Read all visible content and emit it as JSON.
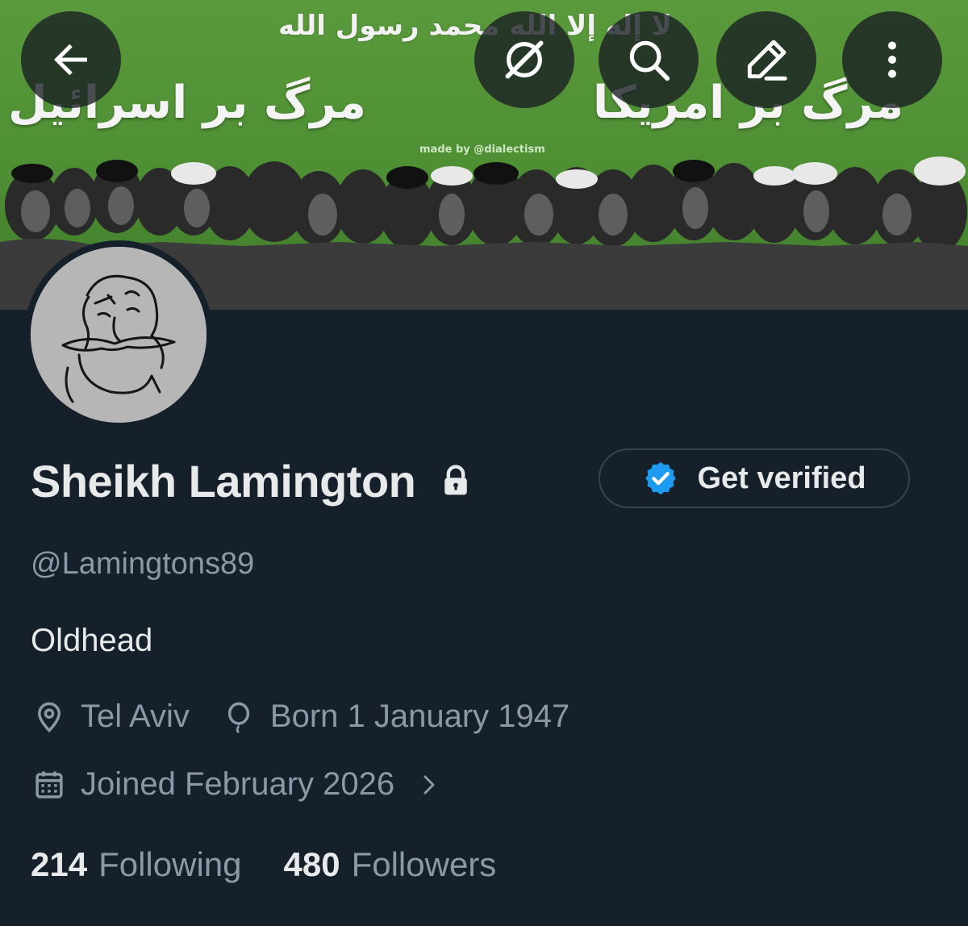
{
  "banner": {
    "shahada": "لا إله إلا الله محمد رسول الله",
    "slogan_left": "مرگ بر اسرائیل",
    "slogan_right": "مرگ بر امریکا",
    "credit": "made by @dialectism"
  },
  "top_bar": {
    "icons": [
      "back-arrow-icon",
      "grok-icon",
      "search-icon",
      "edit-icon",
      "more-vertical-icon"
    ]
  },
  "profile": {
    "display_name": "Sheikh Lamington",
    "protected_icon": "lock-icon",
    "get_verified_label": "Get verified",
    "handle": "@Lamingtons89",
    "bio": "Oldhead",
    "location": "Tel Aviv",
    "birthday": "Born 1 January 1947",
    "joined": "Joined February 2026",
    "following_count": "214",
    "following_label": "Following",
    "followers_count": "480",
    "followers_label": "Followers"
  },
  "colors": {
    "background": "#15202b",
    "text_primary": "#e7e9ea",
    "text_secondary": "#8b98a5",
    "verified_blue": "#1d9bf0",
    "banner_green": "#4e8f34"
  }
}
